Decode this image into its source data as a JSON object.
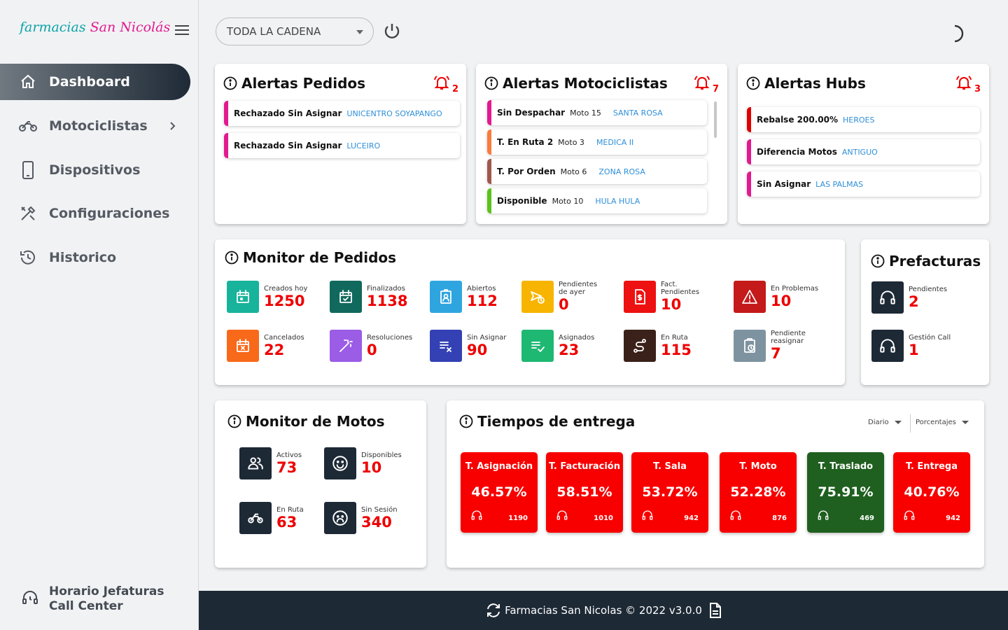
{
  "brand": {
    "part1": "farmacias",
    "part2": "San Nicolás"
  },
  "sidebar": {
    "items": [
      {
        "label": "Dashboard",
        "icon": "home-icon"
      },
      {
        "label": "Motociclistas",
        "icon": "motorcycle-icon"
      },
      {
        "label": "Dispositivos",
        "icon": "phone-icon"
      },
      {
        "label": "Configuraciones",
        "icon": "tools-icon"
      },
      {
        "label": "Historico",
        "icon": "history-icon"
      }
    ],
    "footer": {
      "line1": "Horario Jefaturas",
      "line2": "Call Center"
    }
  },
  "topbar": {
    "select_value": "TODA LA CADENA"
  },
  "alertas_pedidos": {
    "title": "Alertas Pedidos",
    "count": "2",
    "items": [
      {
        "title": "Rechazado Sin Asignar",
        "loc": "UNICENTRO SOYAPANGO",
        "color": "#e2198f"
      },
      {
        "title": "Rechazado Sin Asignar",
        "loc": "LUCEIRO",
        "color": "#e2198f"
      }
    ]
  },
  "alertas_motociclistas": {
    "title": "Alertas Motociclistas",
    "count": "7",
    "items": [
      {
        "title": "Sin Despachar",
        "moto": "Moto 15",
        "loc": "SANTA ROSA",
        "color": "#e2198f"
      },
      {
        "title": "T. En Ruta 2",
        "moto": "Moto 3",
        "loc": "MEDICA II",
        "color": "#f97b3d"
      },
      {
        "title": "T. Por Orden",
        "moto": "Moto 6",
        "loc": "ZONA ROSA",
        "color": "#a0574c"
      },
      {
        "title": "Disponible",
        "moto": "Moto 10",
        "loc": "HULA HULA",
        "color": "#5ac31c"
      }
    ]
  },
  "alertas_hubs": {
    "title": "Alertas Hubs",
    "count": "3",
    "items": [
      {
        "title": "Rebalse 200.00%",
        "loc": "HEROES",
        "color": "#e00000"
      },
      {
        "title": "Diferencia Motos",
        "loc": "ANTIGUO",
        "color": "#e2198f"
      },
      {
        "title": "Sin Asignar",
        "loc": "LAS PALMAS",
        "color": "#e2198f"
      }
    ]
  },
  "monitor_pedidos": {
    "title": "Monitor de Pedidos",
    "stats": [
      {
        "label": "Creados hoy",
        "value": "1250",
        "color": "#17b39b",
        "icon": "calendar-icon"
      },
      {
        "label": "Finalizados",
        "value": "1138",
        "color": "#10695c",
        "icon": "calendar-check-icon"
      },
      {
        "label": "Abiertos",
        "value": "112",
        "color": "#2fa5e0",
        "icon": "id-card-icon"
      },
      {
        "label": "Pendientes de ayer",
        "value": "0",
        "color": "#f7b400",
        "icon": "send-clock-icon"
      },
      {
        "label": "Fact. Pendientes",
        "value": "10",
        "color": "#ee1111",
        "icon": "invoice-icon"
      },
      {
        "label": "En Problemas",
        "value": "10",
        "color": "#c41a1a",
        "icon": "warning-icon"
      },
      {
        "label": "Cancelados",
        "value": "22",
        "color": "#f8691a",
        "icon": "calendar-x-icon"
      },
      {
        "label": "Resoluciones",
        "value": "0",
        "color": "#9b5ce6",
        "icon": "magic-wand-icon"
      },
      {
        "label": "Sin Asignar",
        "value": "90",
        "color": "#3341b4",
        "icon": "list-x-icon"
      },
      {
        "label": "Asignados",
        "value": "23",
        "color": "#1eb873",
        "icon": "list-check-icon"
      },
      {
        "label": "En Ruta",
        "value": "115",
        "color": "#3a211a",
        "icon": "route-icon"
      },
      {
        "label": "Pendiente reasignar",
        "value": "7",
        "color": "#7e93a0",
        "icon": "clipboard-clock-icon"
      }
    ]
  },
  "prefacturas": {
    "title": "Prefacturas",
    "stats": [
      {
        "label": "Pendientes",
        "value": "2",
        "color": "#1d2935",
        "icon": "headset-icon"
      },
      {
        "label": "Gestión Call",
        "value": "1",
        "color": "#1d2935",
        "icon": "headset-icon"
      }
    ]
  },
  "monitor_motos": {
    "title": "Monitor de Motos",
    "stats": [
      {
        "label": "Activos",
        "value": "73",
        "color": "#1d2935",
        "icon": "users-icon"
      },
      {
        "label": "Disponibles",
        "value": "10",
        "color": "#1d2935",
        "icon": "smile-icon"
      },
      {
        "label": "En Ruta",
        "value": "63",
        "color": "#1d2935",
        "icon": "motorcycle-icon"
      },
      {
        "label": "Sin Sesión",
        "value": "340",
        "color": "#1d2935",
        "icon": "sad-icon"
      }
    ]
  },
  "tiempos": {
    "title": "Tiempos de entrega",
    "dropdown1": "Diario",
    "dropdown2": "Porcentajes",
    "cards": [
      {
        "label": "T. Asignación",
        "pct": "46.57%",
        "count": "1190",
        "color": "#f80000"
      },
      {
        "label": "T. Facturación",
        "pct": "58.51%",
        "count": "1010",
        "color": "#f80000"
      },
      {
        "label": "T. Sala",
        "pct": "53.72%",
        "count": "942",
        "color": "#f80000"
      },
      {
        "label": "T. Moto",
        "pct": "52.28%",
        "count": "876",
        "color": "#f80000"
      },
      {
        "label": "T. Traslado",
        "pct": "75.91%",
        "count": "469",
        "color": "#1f5f1f"
      },
      {
        "label": "T. Entrega",
        "pct": "40.76%",
        "count": "942",
        "color": "#f80000"
      }
    ]
  },
  "footer": {
    "text": "Farmacias San Nicolas © 2022 v3.0.0"
  }
}
